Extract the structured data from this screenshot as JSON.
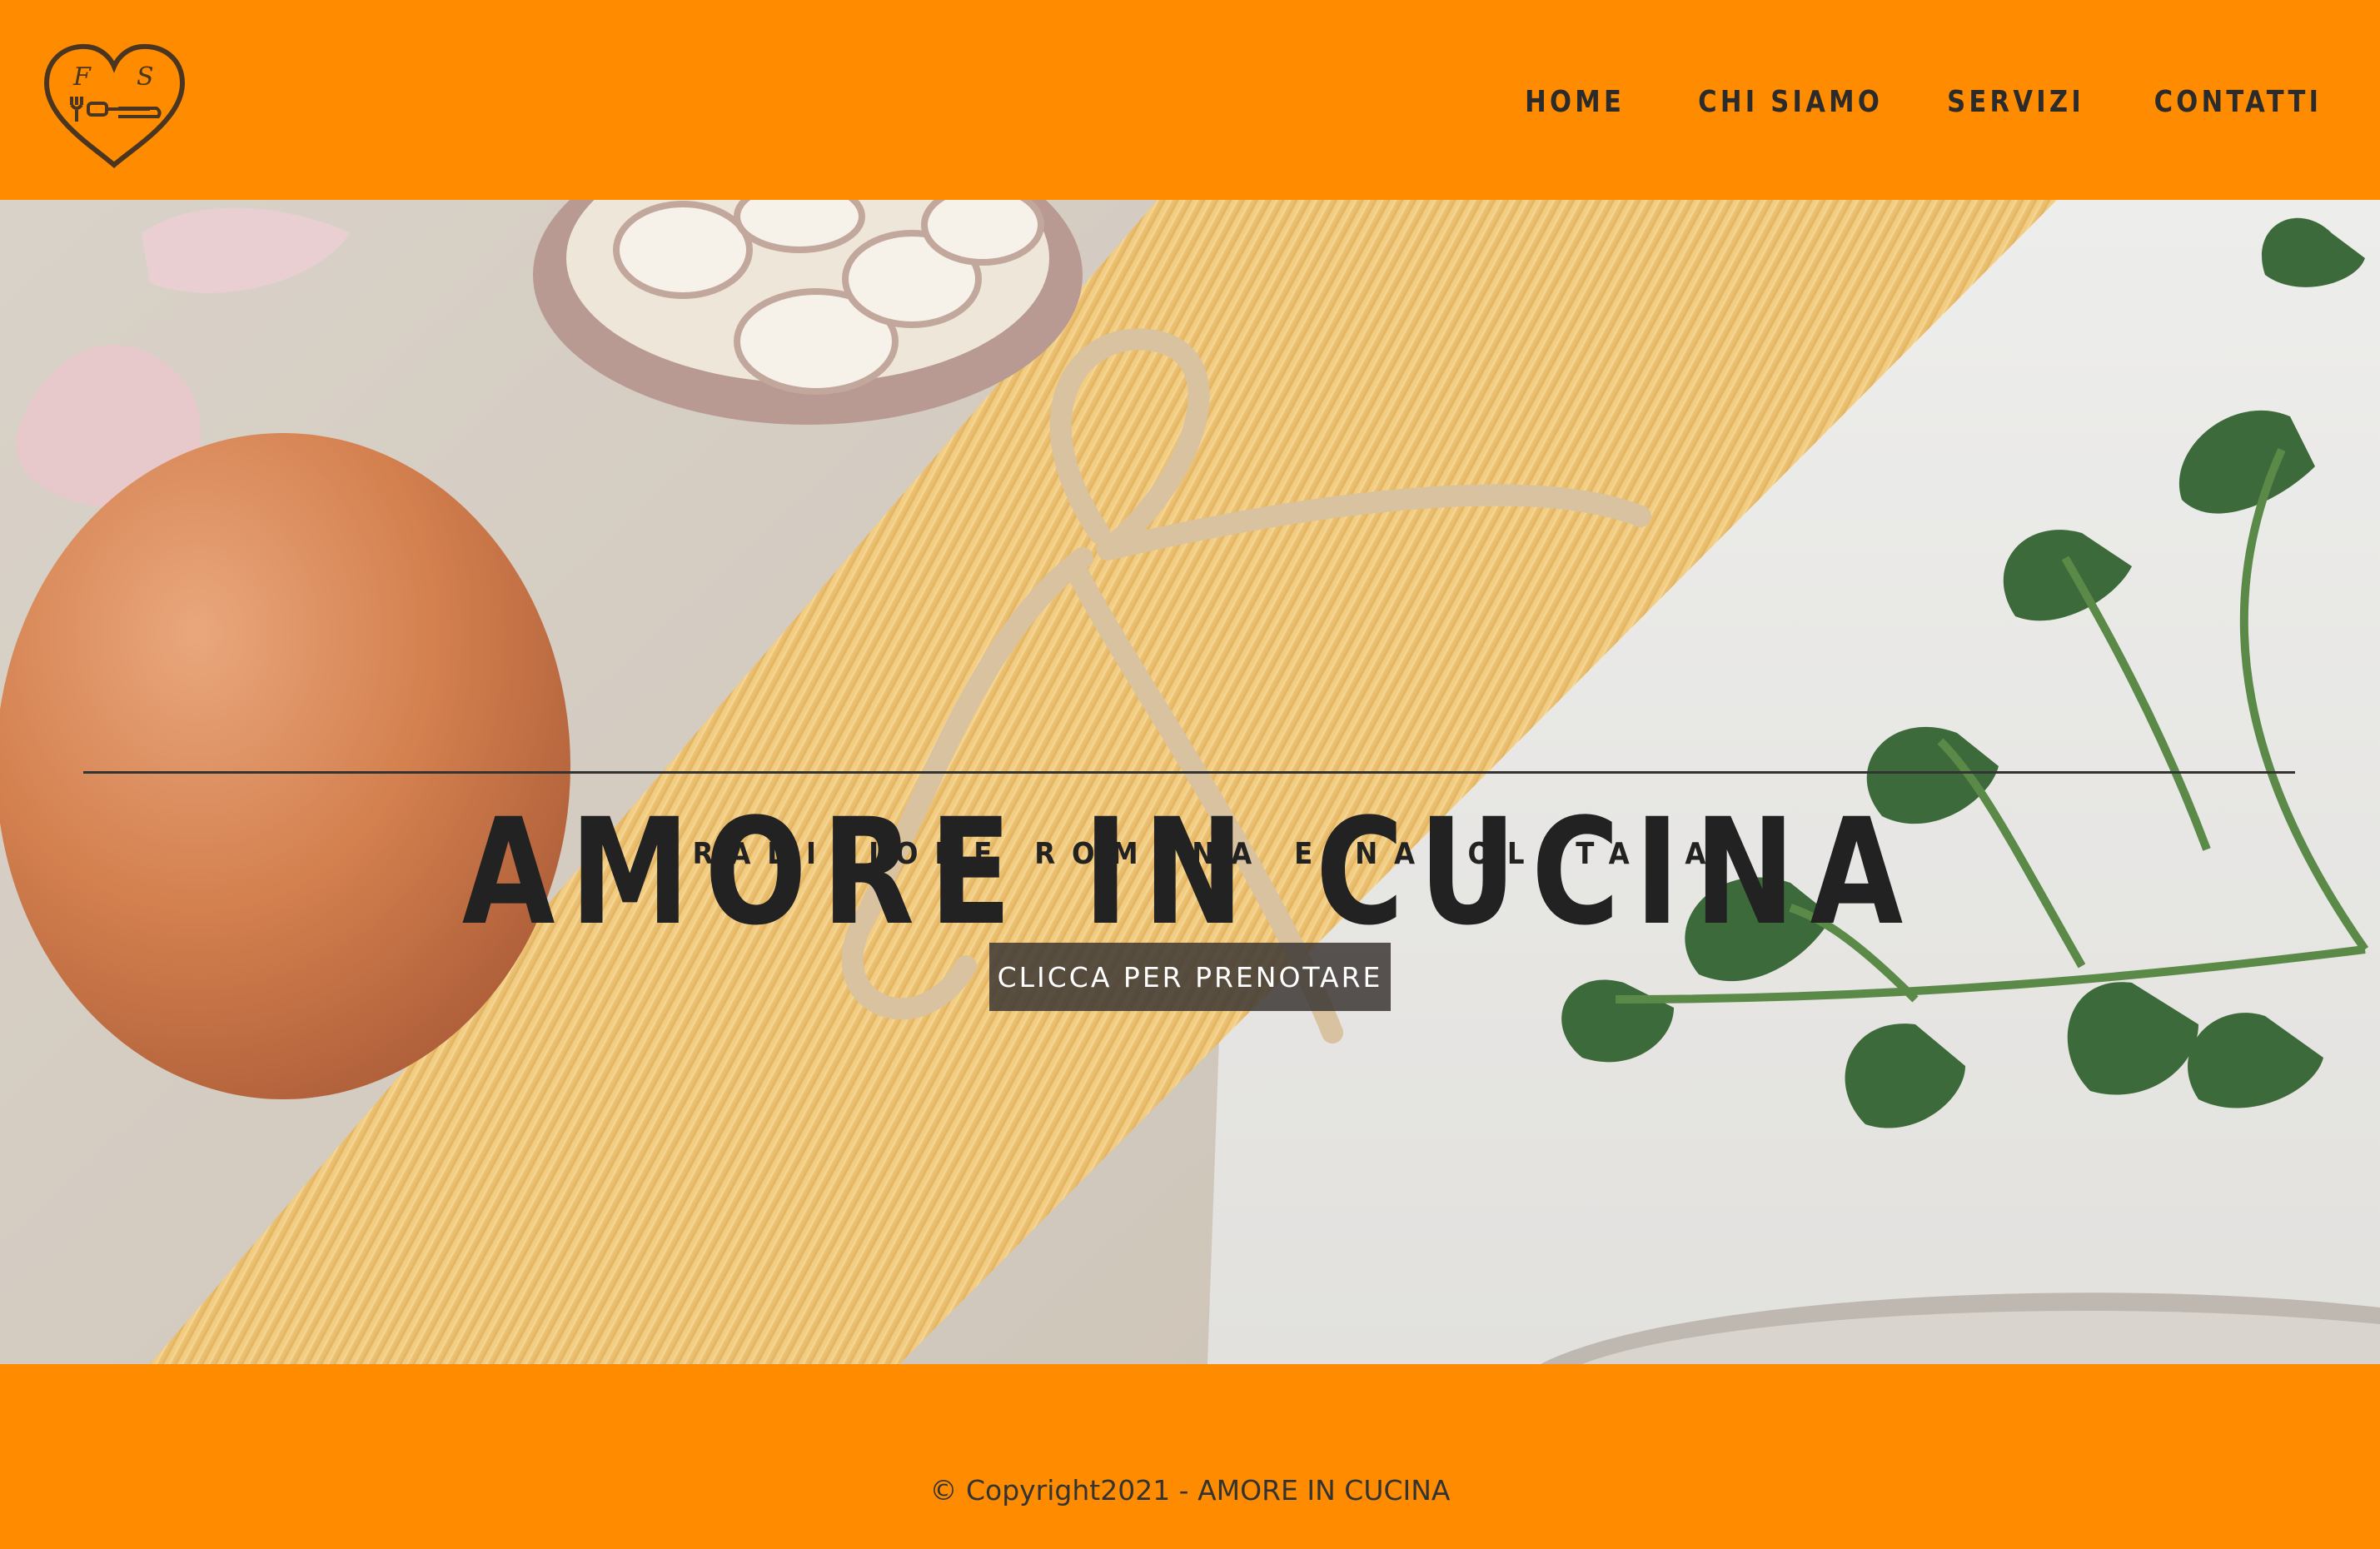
{
  "header": {
    "logo_initials": [
      "F",
      "S"
    ],
    "nav": [
      {
        "label": "HOME"
      },
      {
        "label": "CHI SIAMO"
      },
      {
        "label": "SERVIZI"
      },
      {
        "label": "CONTATTI"
      }
    ]
  },
  "hero": {
    "title": "AMORE IN CUCINA",
    "subtitle": "TRADIZIONE ROMANA E NAPOLETANA",
    "cta_label": "CLICCA PER PRENOTARE",
    "background_icon": "pasta-egg-garlic-parsley-photo"
  },
  "footer": {
    "copyright": "© Copyright2021 - AMORE IN CUCINA"
  },
  "colors": {
    "brand_orange": "#ff8c00",
    "text_dark": "#222222",
    "button_bg": "#3c3734"
  }
}
